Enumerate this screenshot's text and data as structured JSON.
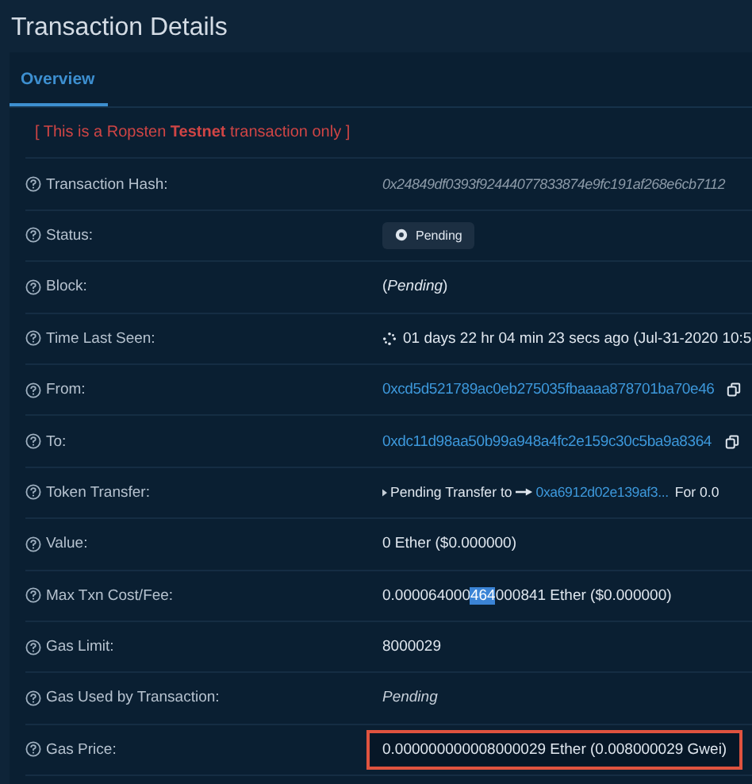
{
  "title": "Transaction Details",
  "tabs": [
    {
      "label": "Overview",
      "selected": true
    }
  ],
  "notice": {
    "before": "[ This is a Ropsten ",
    "bold": "Testnet",
    "after": " transaction only ]"
  },
  "rows": [
    {
      "label": "Transaction Hash:",
      "kind": "hash",
      "value": "0x24849df0393f92444077833874e9fc191af268e6cb7112"
    },
    {
      "label": "Status:",
      "kind": "badge",
      "value": "Pending"
    },
    {
      "label": "Block:",
      "kind": "text",
      "value": "(*Pending*)"
    },
    {
      "label": "Time Last Seen:",
      "kind": "time",
      "value": "01 days 22 hr 04 min 23 secs ago (Jul-31-2020 10:5"
    },
    {
      "label": "From:",
      "kind": "address",
      "value": "0xcd5d521789ac0eb275035fbaaaa878701ba70e46"
    },
    {
      "label": "To:",
      "kind": "address",
      "value": "0xdc11d98aa50b99a948a4fc2e159c30c5ba9a8364"
    },
    {
      "label": "Token Transfer:",
      "kind": "token",
      "value": "Pending Transfer to",
      "link": "0xa6912d02e139af3...",
      "after": "For 0.0"
    },
    {
      "label": "Value:",
      "kind": "text",
      "value": "0 Ether ($0.000000)"
    },
    {
      "label": "Max Txn Cost/Fee:",
      "kind": "selection",
      "before": "0.000064000",
      "selection": "464",
      "after": "000841 Ether ($0.000000)"
    },
    {
      "label": "Gas Limit:",
      "kind": "text",
      "value": "8000029"
    },
    {
      "label": "Gas Used by Transaction:",
      "kind": "italic",
      "value": "Pending"
    },
    {
      "label": "Gas Price:",
      "kind": "text",
      "value": "0.000000000008000029 Ether (0.008000029 Gwei)",
      "highlighted": true
    }
  ]
}
